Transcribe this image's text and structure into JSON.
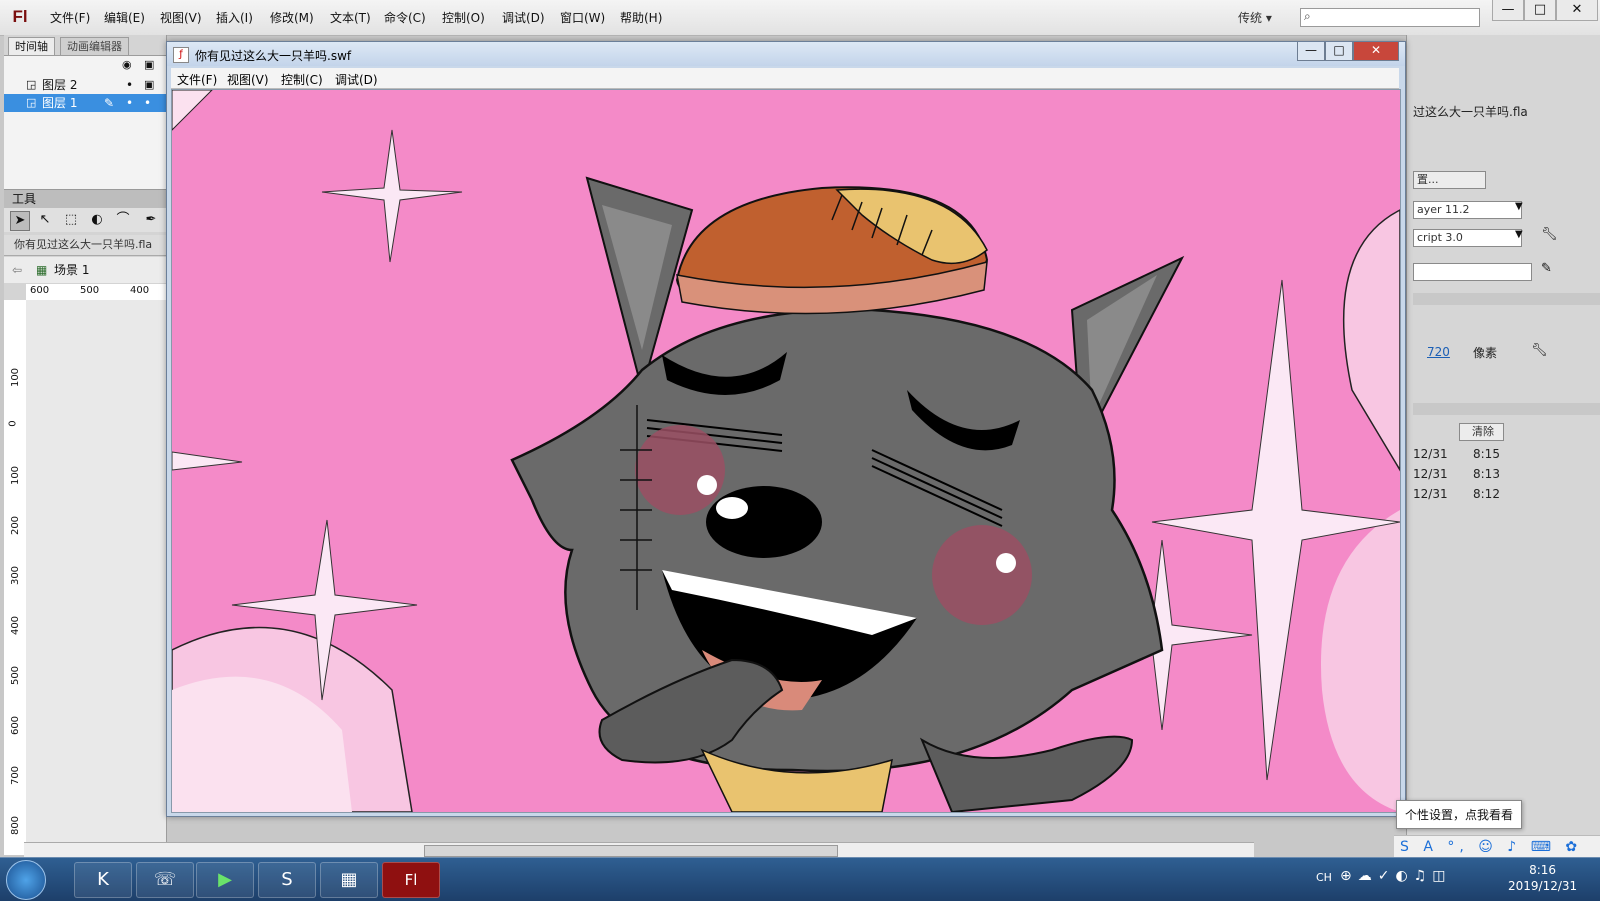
{
  "app": {
    "logo": "Fl",
    "menus": [
      "文件(F)",
      "编辑(E)",
      "视图(V)",
      "插入(I)",
      "修改(M)",
      "文本(T)",
      "命令(C)",
      "控制(O)",
      "调试(D)",
      "窗口(W)",
      "帮助(H)"
    ],
    "workspace": "传统",
    "search_icon": "⌕",
    "window_controls": [
      "—",
      "□",
      "✕"
    ]
  },
  "left_panel": {
    "tabs": [
      "时间轴",
      "动画编辑器"
    ],
    "layers": [
      {
        "name": "图层 2",
        "selected": false
      },
      {
        "name": "图层 1",
        "selected": true
      }
    ],
    "tools_header": "工具",
    "tools": [
      "➤",
      "↖",
      "⬚",
      "◐",
      "⌒",
      "✒"
    ],
    "doc_tab": "你有见过这么大一只羊吗.fla",
    "scene": "场景 1",
    "ruler_h": [
      "600",
      "500",
      "400"
    ],
    "ruler_v": [
      "100",
      "0",
      "100",
      "200",
      "300",
      "400",
      "500",
      "600",
      "700",
      "800"
    ]
  },
  "right_panel": {
    "file_name": "过这么大一只羊吗.fla",
    "settings_button": "置...",
    "player": "ayer 11.2",
    "script": "cript 3.0",
    "size_value": "720",
    "size_unit": "像素",
    "clear_button": "清除",
    "history": [
      {
        "date": "12/31",
        "time": "8:15"
      },
      {
        "date": "12/31",
        "time": "8:13"
      },
      {
        "date": "12/31",
        "time": "8:12"
      }
    ]
  },
  "swf_window": {
    "title": "你有见过这么大一只羊吗.swf",
    "menus": [
      "文件(F)",
      "视图(V)",
      "控制(C)",
      "调试(D)"
    ],
    "controls": [
      "—",
      "□",
      "✕"
    ]
  },
  "tooltip": "个性设置，点我看看",
  "taskbar": {
    "start_icon": "start-orb",
    "apps": [
      "K",
      "☏",
      "▶",
      "S",
      "▦",
      "Fl"
    ],
    "ime_icons": "S A °, ☺ ♪ ⌨ ✿ ⊞",
    "tray_lang": "CH",
    "time": "8:16",
    "date": "2019/12/31"
  },
  "colors": {
    "stage_pink": "#f48ac8",
    "wolf_grey": "#6a6a6a",
    "hat_orange": "#c0602f",
    "cheek": "#9a4f63"
  }
}
